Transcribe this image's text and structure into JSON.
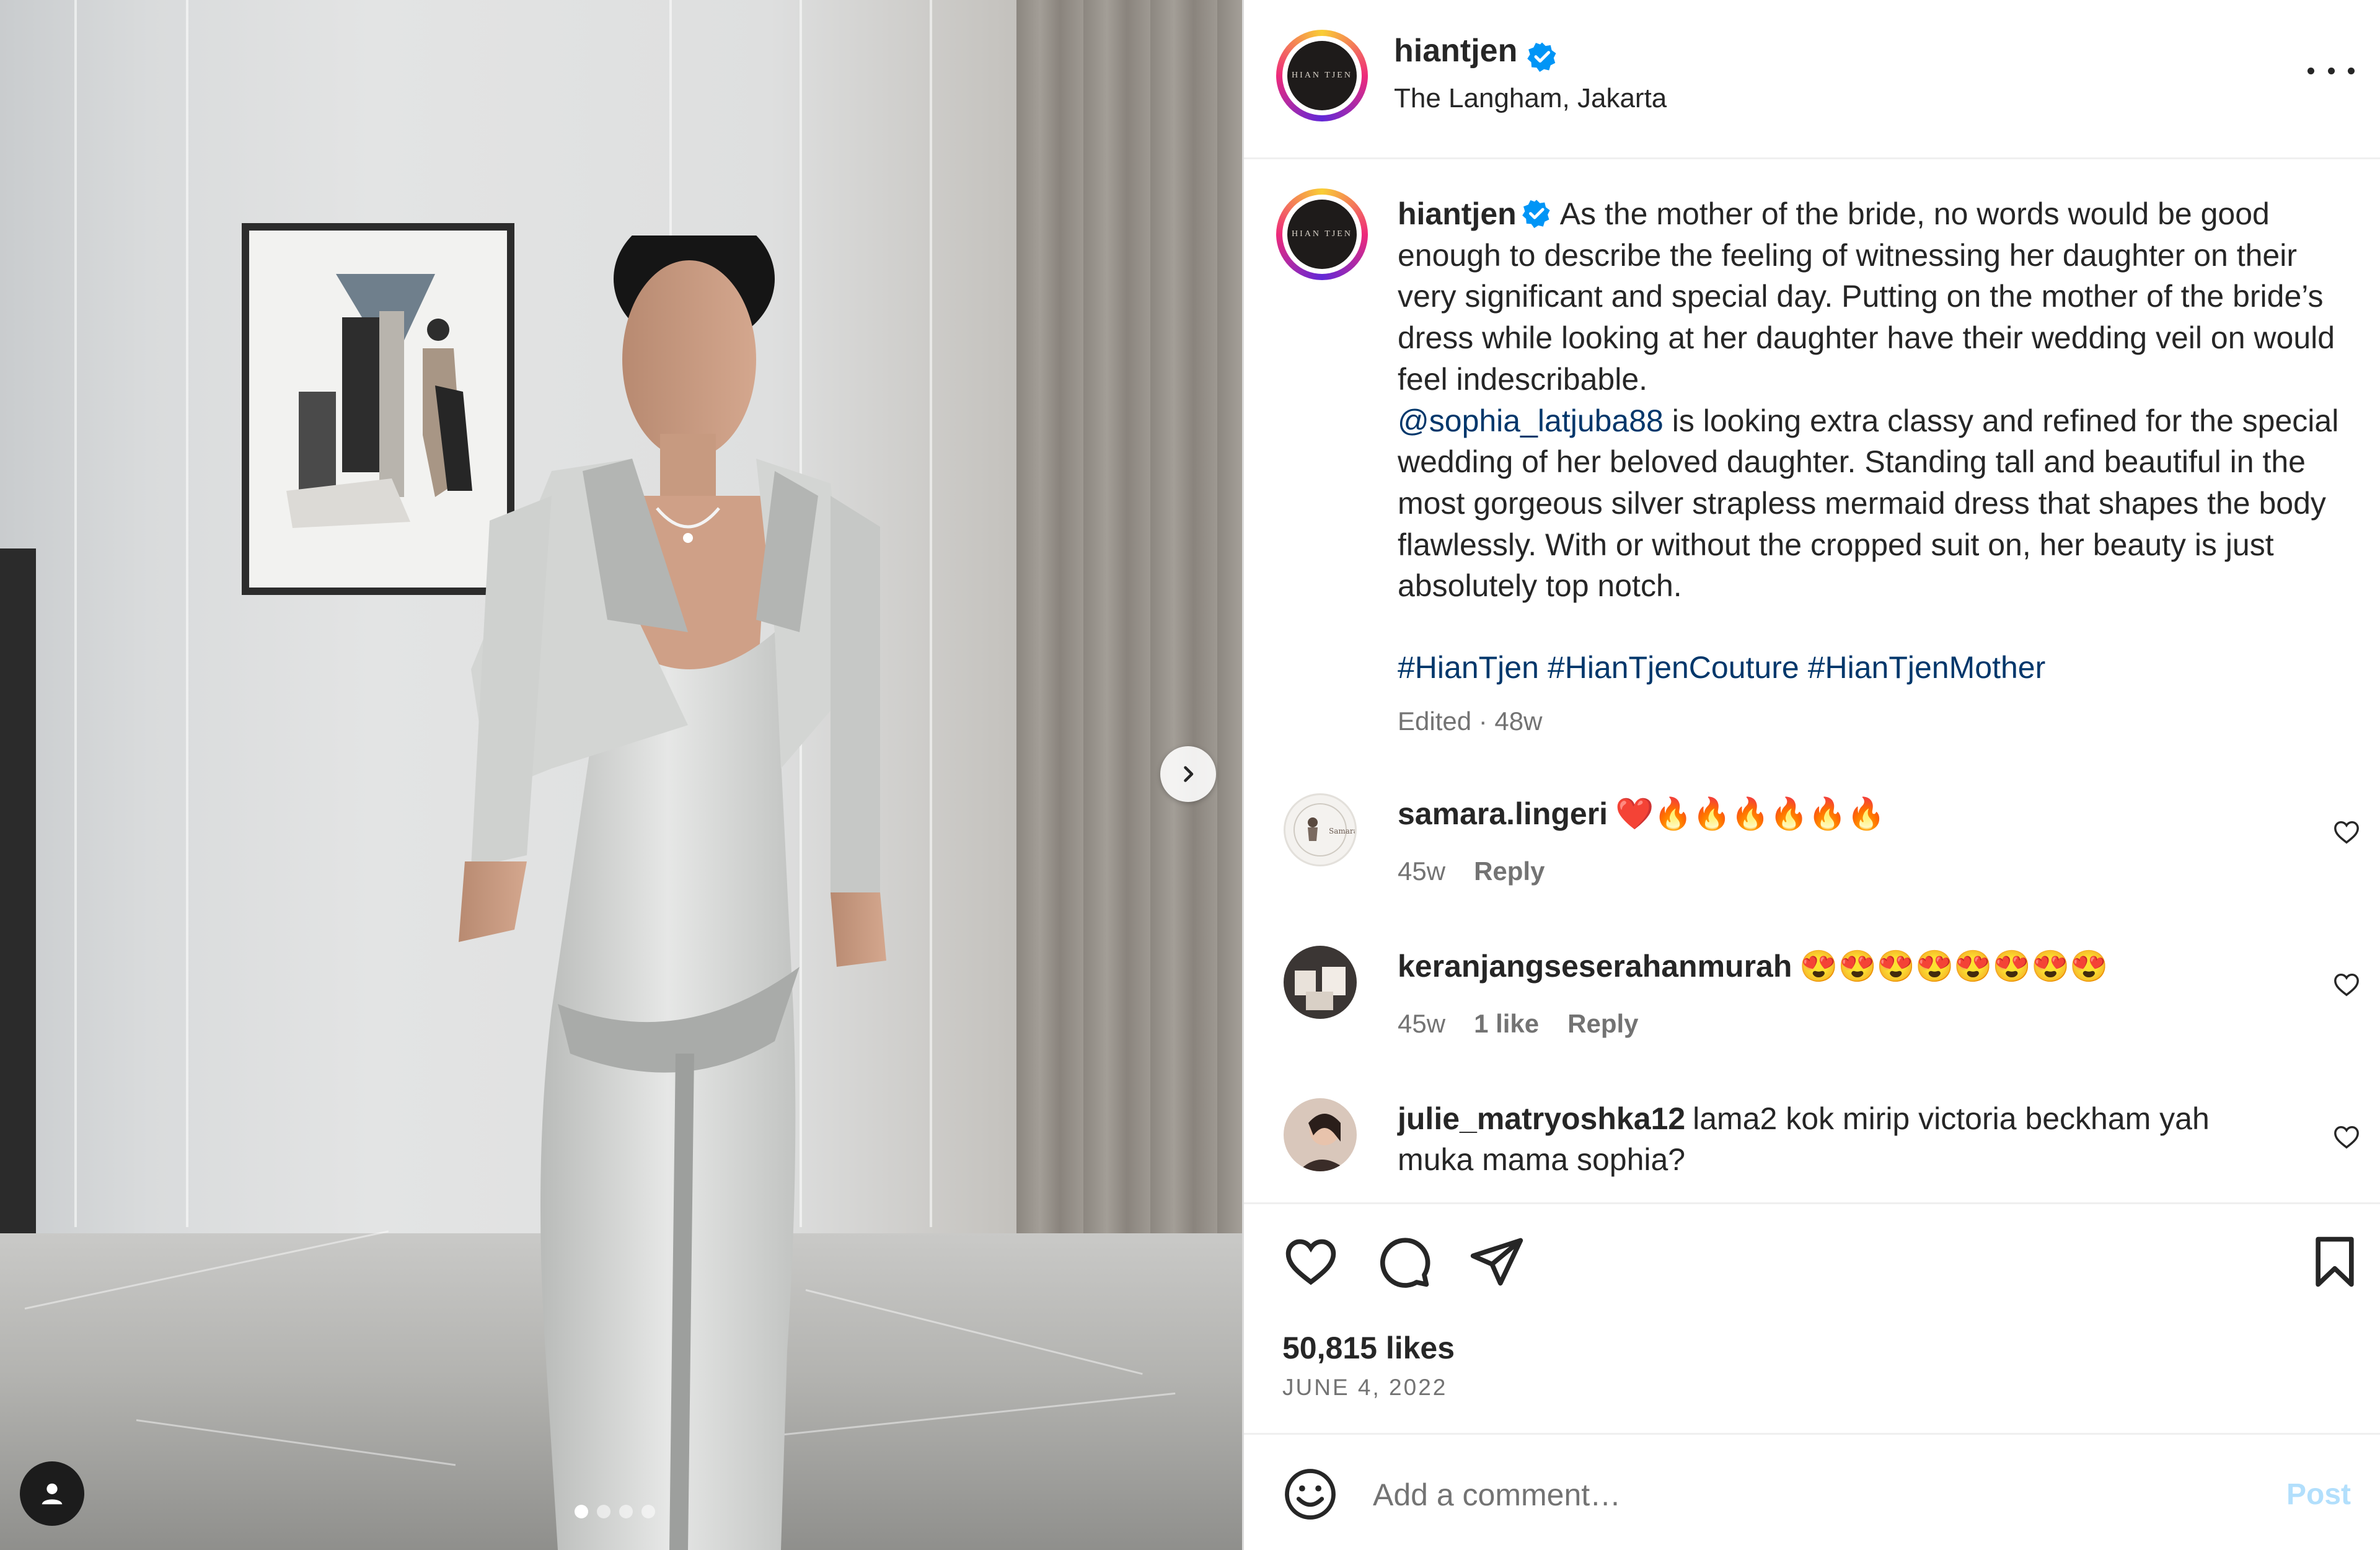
{
  "post": {
    "username": "hiantjen",
    "location": "The Langham, Jakarta",
    "avatar_logo_text": "HIAN TJEN",
    "caption": {
      "text_1": "As the mother of the bride, no words would be good enough to describe the feeling of witnessing her daughter on their very significant and special day. Putting on the mother of the bride’s dress while looking at her daughter have their wedding veil on would feel indescribable.",
      "mention": "@sophia_latjuba88",
      "text_2": " is looking extra classy and refined for the special wedding of her beloved daughter. Standing tall and beautiful in the most gorgeous silver strapless mermaid dress that shapes the body flawlessly. With or without the cropped suit on, her beauty is just absolutely top notch.",
      "hashtags": [
        "#HianTjen",
        "#HianTjenCouture",
        "#HianTjenMother"
      ],
      "edited": "Edited · 48w"
    },
    "likes": "50,815 likes",
    "date": "JUNE 4, 2022",
    "carousel": {
      "count": 4,
      "active": 0
    }
  },
  "comments": [
    {
      "username": "samara.lingeri",
      "text": "❤️🔥🔥🔥🔥🔥🔥",
      "time": "45w",
      "likes": "",
      "reply": "Reply",
      "avatar_text": "Samara"
    },
    {
      "username": "keranjangseserahanmurah",
      "text": "😍😍😍😍😍😍😍😍",
      "time": "45w",
      "likes": "1 like",
      "reply": "Reply",
      "avatar_text": ""
    },
    {
      "username": "julie_matryoshka12",
      "text": "lama2 kok mirip victoria beckham yah muka mama sophia?",
      "time": "",
      "likes": "",
      "reply": "",
      "avatar_text": ""
    }
  ],
  "composer": {
    "placeholder": "Add a comment…",
    "post_label": "Post"
  },
  "colors": {
    "link": "#00376b",
    "secondary": "#737373",
    "verified": "#0095f6",
    "post_disabled": "#b2dffc"
  },
  "icons": [
    "verified-icon",
    "more-icon",
    "chevron-right-icon",
    "user-tag-icon",
    "heart-icon",
    "comment-icon",
    "share-icon",
    "bookmark-icon",
    "emoji-icon"
  ]
}
